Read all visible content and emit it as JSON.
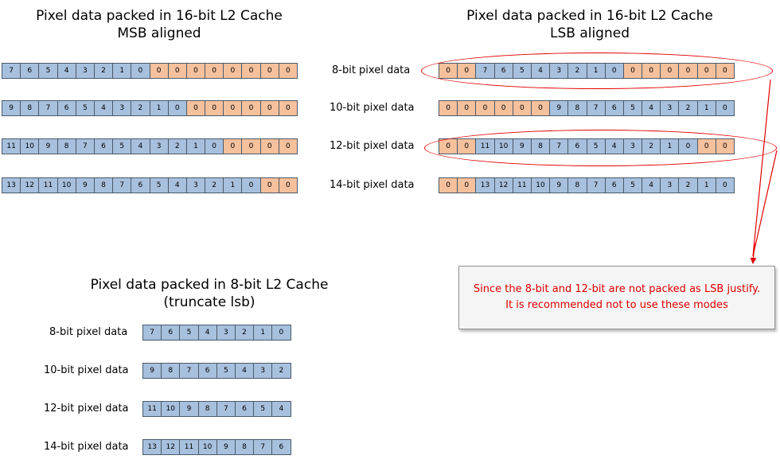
{
  "msb_panel": {
    "title_line1": "Pixel data packed in 16-bit L2 Cache",
    "title_line2": "MSB aligned",
    "rows": [
      {
        "cells": [
          [
            "7",
            "b"
          ],
          [
            "6",
            "b"
          ],
          [
            "5",
            "b"
          ],
          [
            "4",
            "b"
          ],
          [
            "3",
            "b"
          ],
          [
            "2",
            "b"
          ],
          [
            "1",
            "b"
          ],
          [
            "0",
            "b"
          ],
          [
            "0",
            "o"
          ],
          [
            "0",
            "o"
          ],
          [
            "0",
            "o"
          ],
          [
            "0",
            "o"
          ],
          [
            "0",
            "o"
          ],
          [
            "0",
            "o"
          ],
          [
            "0",
            "o"
          ],
          [
            "0",
            "o"
          ]
        ]
      },
      {
        "cells": [
          [
            "9",
            "b"
          ],
          [
            "8",
            "b"
          ],
          [
            "7",
            "b"
          ],
          [
            "6",
            "b"
          ],
          [
            "5",
            "b"
          ],
          [
            "4",
            "b"
          ],
          [
            "3",
            "b"
          ],
          [
            "2",
            "b"
          ],
          [
            "1",
            "b"
          ],
          [
            "0",
            "b"
          ],
          [
            "0",
            "o"
          ],
          [
            "0",
            "o"
          ],
          [
            "0",
            "o"
          ],
          [
            "0",
            "o"
          ],
          [
            "0",
            "o"
          ],
          [
            "0",
            "o"
          ]
        ]
      },
      {
        "cells": [
          [
            "11",
            "b"
          ],
          [
            "10",
            "b"
          ],
          [
            "9",
            "b"
          ],
          [
            "8",
            "b"
          ],
          [
            "7",
            "b"
          ],
          [
            "6",
            "b"
          ],
          [
            "5",
            "b"
          ],
          [
            "4",
            "b"
          ],
          [
            "3",
            "b"
          ],
          [
            "2",
            "b"
          ],
          [
            "1",
            "b"
          ],
          [
            "0",
            "b"
          ],
          [
            "0",
            "o"
          ],
          [
            "0",
            "o"
          ],
          [
            "0",
            "o"
          ],
          [
            "0",
            "o"
          ]
        ]
      },
      {
        "cells": [
          [
            "13",
            "b"
          ],
          [
            "12",
            "b"
          ],
          [
            "11",
            "b"
          ],
          [
            "10",
            "b"
          ],
          [
            "9",
            "b"
          ],
          [
            "8",
            "b"
          ],
          [
            "7",
            "b"
          ],
          [
            "6",
            "b"
          ],
          [
            "5",
            "b"
          ],
          [
            "4",
            "b"
          ],
          [
            "3",
            "b"
          ],
          [
            "2",
            "b"
          ],
          [
            "1",
            "b"
          ],
          [
            "0",
            "b"
          ],
          [
            "0",
            "o"
          ],
          [
            "0",
            "o"
          ]
        ]
      }
    ]
  },
  "row_labels": [
    "8-bit pixel data",
    "10-bit pixel data",
    "12-bit pixel data",
    "14-bit pixel data"
  ],
  "lsb_panel": {
    "title_line1": "Pixel data packed in 16-bit L2 Cache",
    "title_line2": "LSB aligned",
    "rows": [
      {
        "cells": [
          [
            "0",
            "o"
          ],
          [
            "0",
            "o"
          ],
          [
            "7",
            "b"
          ],
          [
            "6",
            "b"
          ],
          [
            "5",
            "b"
          ],
          [
            "4",
            "b"
          ],
          [
            "3",
            "b"
          ],
          [
            "2",
            "b"
          ],
          [
            "1",
            "b"
          ],
          [
            "0",
            "b"
          ],
          [
            "0",
            "o"
          ],
          [
            "0",
            "o"
          ],
          [
            "0",
            "o"
          ],
          [
            "0",
            "o"
          ],
          [
            "0",
            "o"
          ],
          [
            "0",
            "o"
          ]
        ]
      },
      {
        "cells": [
          [
            "0",
            "o"
          ],
          [
            "0",
            "o"
          ],
          [
            "0",
            "o"
          ],
          [
            "0",
            "o"
          ],
          [
            "0",
            "o"
          ],
          [
            "0",
            "o"
          ],
          [
            "9",
            "b"
          ],
          [
            "8",
            "b"
          ],
          [
            "7",
            "b"
          ],
          [
            "6",
            "b"
          ],
          [
            "5",
            "b"
          ],
          [
            "4",
            "b"
          ],
          [
            "3",
            "b"
          ],
          [
            "2",
            "b"
          ],
          [
            "1",
            "b"
          ],
          [
            "0",
            "b"
          ]
        ]
      },
      {
        "cells": [
          [
            "0",
            "o"
          ],
          [
            "0",
            "o"
          ],
          [
            "11",
            "b"
          ],
          [
            "10",
            "b"
          ],
          [
            "9",
            "b"
          ],
          [
            "8",
            "b"
          ],
          [
            "7",
            "b"
          ],
          [
            "6",
            "b"
          ],
          [
            "5",
            "b"
          ],
          [
            "4",
            "b"
          ],
          [
            "3",
            "b"
          ],
          [
            "2",
            "b"
          ],
          [
            "1",
            "b"
          ],
          [
            "0",
            "b"
          ],
          [
            "0",
            "o"
          ],
          [
            "0",
            "o"
          ]
        ]
      },
      {
        "cells": [
          [
            "0",
            "o"
          ],
          [
            "0",
            "o"
          ],
          [
            "13",
            "b"
          ],
          [
            "12",
            "b"
          ],
          [
            "11",
            "b"
          ],
          [
            "10",
            "b"
          ],
          [
            "9",
            "b"
          ],
          [
            "8",
            "b"
          ],
          [
            "7",
            "b"
          ],
          [
            "6",
            "b"
          ],
          [
            "5",
            "b"
          ],
          [
            "4",
            "b"
          ],
          [
            "3",
            "b"
          ],
          [
            "2",
            "b"
          ],
          [
            "1",
            "b"
          ],
          [
            "0",
            "b"
          ]
        ]
      }
    ]
  },
  "truncate_panel": {
    "title_line1": "Pixel data packed in 8-bit L2 Cache",
    "title_line2": "(truncate lsb)",
    "rows": [
      {
        "label": "8-bit pixel data",
        "cells": [
          [
            "7",
            "b"
          ],
          [
            "6",
            "b"
          ],
          [
            "5",
            "b"
          ],
          [
            "4",
            "b"
          ],
          [
            "3",
            "b"
          ],
          [
            "2",
            "b"
          ],
          [
            "1",
            "b"
          ],
          [
            "0",
            "b"
          ]
        ]
      },
      {
        "label": "10-bit pixel data",
        "cells": [
          [
            "9",
            "b"
          ],
          [
            "8",
            "b"
          ],
          [
            "7",
            "b"
          ],
          [
            "6",
            "b"
          ],
          [
            "5",
            "b"
          ],
          [
            "4",
            "b"
          ],
          [
            "3",
            "b"
          ],
          [
            "2",
            "b"
          ]
        ]
      },
      {
        "label": "12-bit pixel data",
        "cells": [
          [
            "11",
            "b"
          ],
          [
            "10",
            "b"
          ],
          [
            "9",
            "b"
          ],
          [
            "8",
            "b"
          ],
          [
            "7",
            "b"
          ],
          [
            "6",
            "b"
          ],
          [
            "5",
            "b"
          ],
          [
            "4",
            "b"
          ]
        ]
      },
      {
        "label": "14-bit pixel data",
        "cells": [
          [
            "13",
            "b"
          ],
          [
            "12",
            "b"
          ],
          [
            "11",
            "b"
          ],
          [
            "10",
            "b"
          ],
          [
            "9",
            "b"
          ],
          [
            "8",
            "b"
          ],
          [
            "7",
            "b"
          ],
          [
            "6",
            "b"
          ]
        ]
      }
    ]
  },
  "note": {
    "line1": "Since the 8-bit and 12-bit are not packed as LSB justify.",
    "line2": "It is recommended not to use these modes"
  },
  "colors": {
    "data_bit": "#a7c0de",
    "padding_bit": "#f5c09c",
    "highlight": "#e30000",
    "note_text": "#e00000"
  }
}
